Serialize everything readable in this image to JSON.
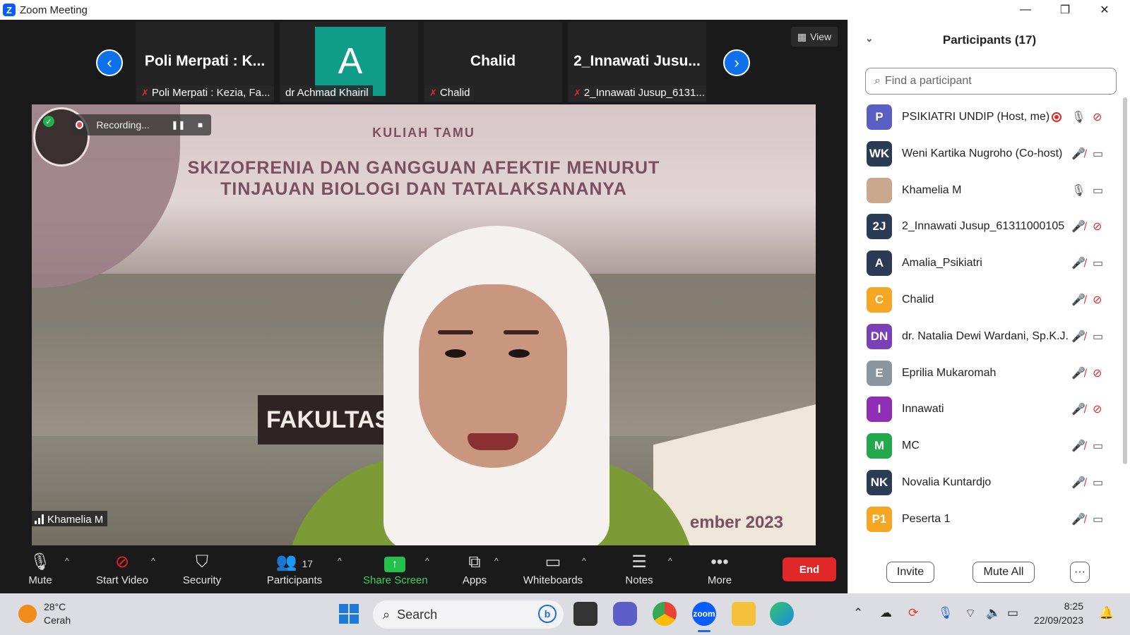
{
  "window": {
    "title": "Zoom Meeting",
    "logo_letter": "Z",
    "minimize": "—",
    "restore": "❐",
    "close": "✕"
  },
  "gallery": {
    "prev": "‹",
    "next": "›",
    "view_label": "View",
    "thumbs": [
      {
        "big": "Poli Merpati : K...",
        "label": "Poli Merpati : Kezia, Fa...",
        "muted": true
      },
      {
        "big": "A",
        "label": "dr Achmad Khairil",
        "muted": false
      },
      {
        "big": "Chalid",
        "label": "Chalid",
        "muted": true
      },
      {
        "big": "2_Innawati  Jusu...",
        "label": "2_Innawati Jusup_6131...",
        "muted": true
      }
    ]
  },
  "main_video": {
    "recording_label": "Recording...",
    "pause_icon": "❚❚",
    "stop_icon": "■",
    "slide_heading": "KULIAH TAMU",
    "slide_title_1": "SKIZOFRENIA DAN GANGGUAN AFEKTIF MENURUT",
    "slide_title_2": "TINJAUAN BIOLOGI DAN TATALAKSANANYA",
    "sign_text": "FAKULTAS",
    "date_text": "ember 2023",
    "speaker_name": "Khamelia M"
  },
  "toolbar": {
    "mute": "Mute",
    "start_video": "Start Video",
    "security": "Security",
    "participants": "Participants",
    "participants_count": "17",
    "share_screen": "Share Screen",
    "apps": "Apps",
    "whiteboards": "Whiteboards",
    "notes": "Notes",
    "more": "More",
    "end": "End",
    "caret": "^"
  },
  "panel": {
    "title": "Participants (17)",
    "collapse_icon": "⌄",
    "search_placeholder": "Find a participant",
    "invite": "Invite",
    "mute_all": "Mute All",
    "more": "···",
    "participants": [
      {
        "initials": "P",
        "name": "PSIKIATRI UNDIP (Host, me)",
        "color": "#5a5fc4",
        "mic_muted": false,
        "cam_off": true,
        "recording": true
      },
      {
        "initials": "WK",
        "name": "Weni Kartika Nugroho (Co-host)",
        "color": "#2b3a55",
        "mic_muted": true,
        "cam_off": false,
        "recording": false
      },
      {
        "initials": "",
        "name": "Khamelia M",
        "color": "#c9a88f",
        "mic_muted": false,
        "cam_off": false,
        "recording": false
      },
      {
        "initials": "2J",
        "name": "2_Innawati Jusup_61311000105",
        "color": "#2b3a55",
        "mic_muted": true,
        "cam_off": true,
        "recording": false
      },
      {
        "initials": "A",
        "name": "Amalia_Psikiatri",
        "color": "#2b3a55",
        "mic_muted": true,
        "cam_off": false,
        "recording": false
      },
      {
        "initials": "C",
        "name": "Chalid",
        "color": "#f5a623",
        "mic_muted": true,
        "cam_off": true,
        "recording": false
      },
      {
        "initials": "DN",
        "name": "dr. Natalia Dewi Wardani, Sp.K.J.",
        "color": "#7b3fb8",
        "mic_muted": true,
        "cam_off": false,
        "recording": false
      },
      {
        "initials": "E",
        "name": "Eprilia Mukaromah",
        "color": "#8c96a0",
        "mic_muted": true,
        "cam_off": true,
        "recording": false
      },
      {
        "initials": "I",
        "name": "Innawati",
        "color": "#8e2fb5",
        "mic_muted": true,
        "cam_off": true,
        "recording": false
      },
      {
        "initials": "M",
        "name": "MC",
        "color": "#23a94b",
        "mic_muted": true,
        "cam_off": false,
        "recording": false
      },
      {
        "initials": "NK",
        "name": "Novalia Kuntardjo",
        "color": "#2b3a55",
        "mic_muted": true,
        "cam_off": false,
        "recording": false
      },
      {
        "initials": "P1",
        "name": "Peserta 1",
        "color": "#f5a623",
        "mic_muted": true,
        "cam_off": false,
        "recording": false
      }
    ]
  },
  "taskbar": {
    "temp": "28°C",
    "weather": "Cerah",
    "search": "Search",
    "bing": "b",
    "zoom_app": "zoom",
    "time": "8:25",
    "date": "22/09/2023"
  }
}
